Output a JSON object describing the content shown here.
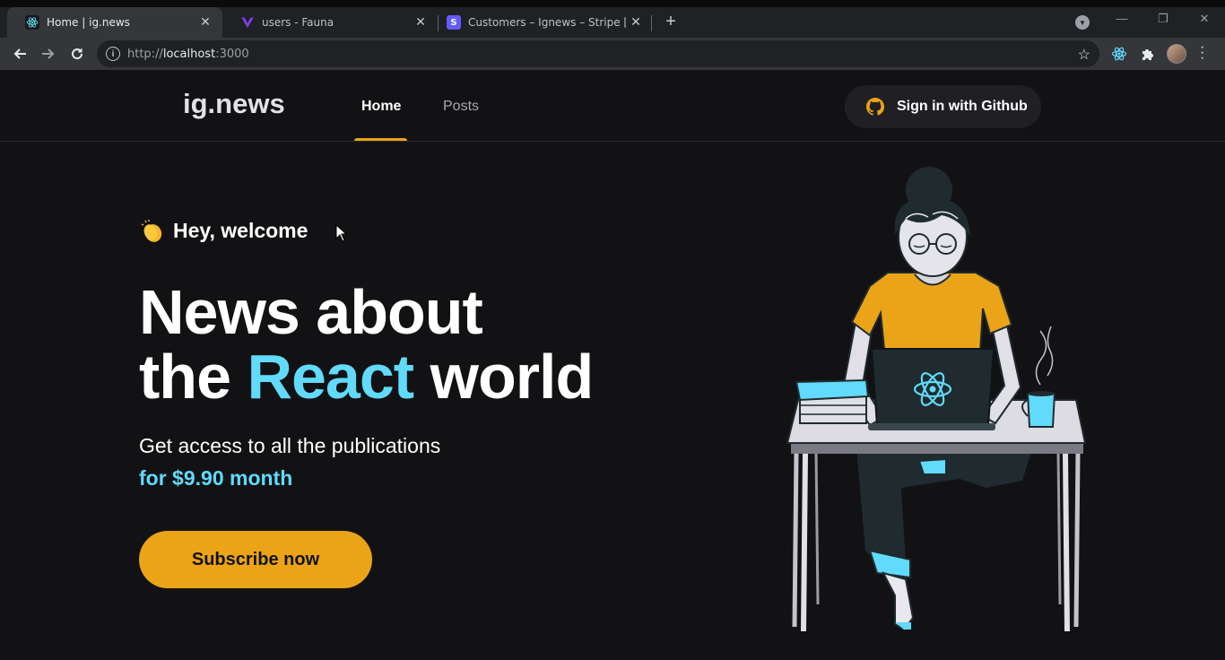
{
  "browser": {
    "tabs": [
      {
        "title": "Home | ig.news",
        "active": true,
        "favicon": "react-icon"
      },
      {
        "title": "users - Fauna",
        "active": false,
        "favicon": "fauna-icon"
      },
      {
        "title": "Customers – Ignews – Stripe [Test]",
        "active": false,
        "favicon": "stripe-icon"
      }
    ],
    "close_glyph": "✕",
    "new_tab_glyph": "+",
    "url_scheme": "http://",
    "url_host": "localhost",
    "url_port": ":3000",
    "info_glyph": "i",
    "star_glyph": "☆",
    "window_controls": {
      "minimize": "—",
      "restore": "❐",
      "close": "✕"
    }
  },
  "site": {
    "logo": "ig.news",
    "nav": [
      {
        "label": "Home",
        "active": true
      },
      {
        "label": "Posts",
        "active": false
      }
    ],
    "signin_label": "Sign in with Github"
  },
  "hero": {
    "greeting": "Hey, welcome",
    "headline_line1": "News about",
    "headline_line2_prefix": "the ",
    "headline_accent": "React",
    "headline_line2_suffix": " world",
    "subtitle": "Get access to all the publications",
    "price": "for $9.90 month",
    "cta_label": "Subscribe now"
  },
  "colors": {
    "background": "#121214",
    "accent_yellow": "#eba417",
    "accent_cyan": "#61dafb",
    "header_button": "#202024"
  }
}
